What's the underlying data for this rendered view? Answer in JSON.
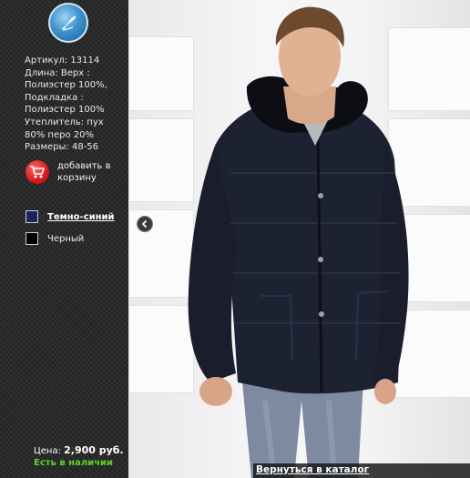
{
  "product": {
    "article": "Артикул: 13114",
    "lines": [
      "Длина: Верх :",
      "Полиэстер 100%,",
      "Подкладка :",
      "Полиэстер 100%",
      "Утеплитель: пух",
      "80% перо 20%",
      "Размеры: 48-56"
    ]
  },
  "cart": {
    "label": "добавить в корзину",
    "icon": "shopping-cart-icon"
  },
  "colors": [
    {
      "name": "Темно-синий",
      "swatch": "#16265a",
      "selected": true
    },
    {
      "name": "Черный",
      "swatch": "#000000",
      "selected": false
    }
  ],
  "price": {
    "label": "Цена:",
    "value": "2,900 руб."
  },
  "stock": "Есть в наличии",
  "back_link": "Вернуться в каталог",
  "palette": {
    "sidebar": "#2a2a2a",
    "stock": "#5fd02a",
    "cart": "#d71919",
    "logo": "#3f93cf"
  }
}
